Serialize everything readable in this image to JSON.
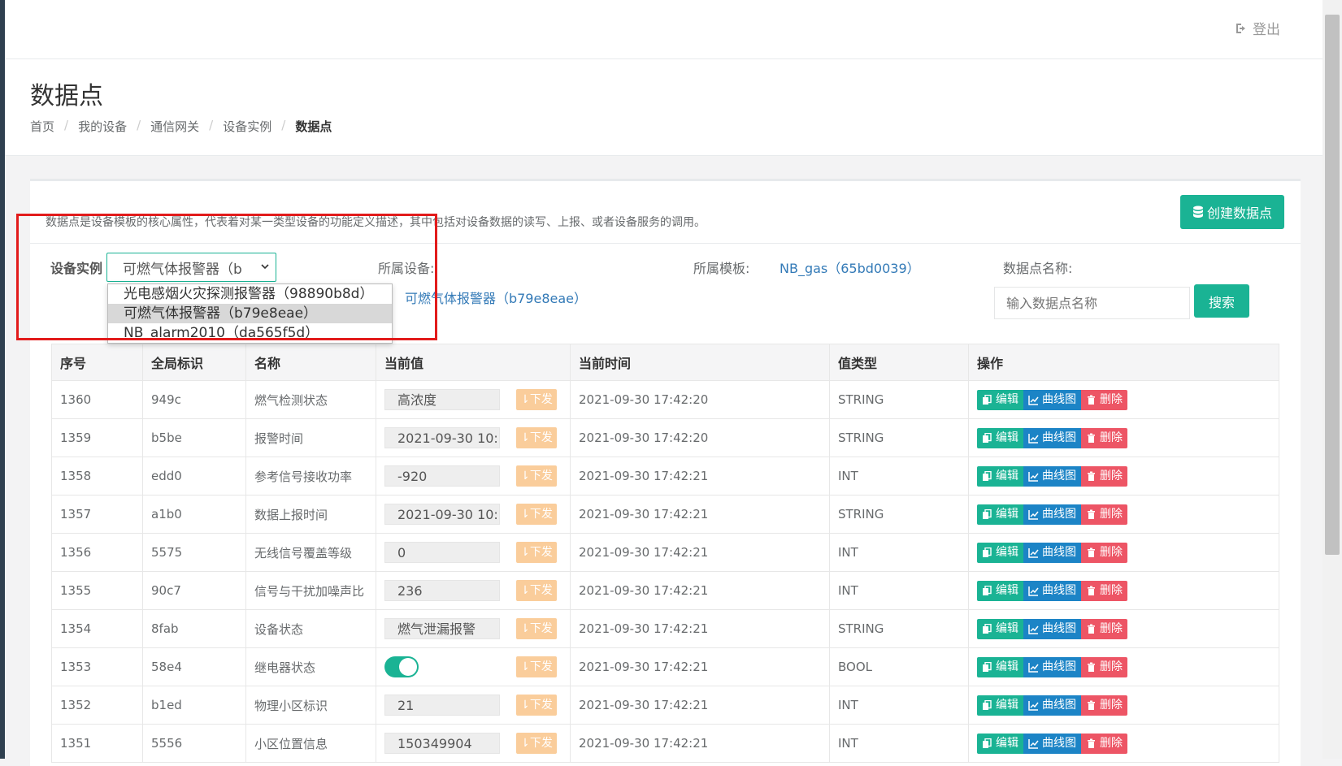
{
  "header": {
    "logout_label": "登出"
  },
  "page": {
    "title": "数据点",
    "breadcrumb": [
      "首页",
      "我的设备",
      "通信网关",
      "设备实例",
      "数据点"
    ]
  },
  "panel": {
    "description": "数据点是设备模板的核心属性，代表着对某一类型设备的功能定义描述，其中包括对设备数据的读写、上报、或者设备服务的调用。",
    "create_button": "创建数据点"
  },
  "filters": {
    "instance_label": "设备实例",
    "instance_selected": "可燃气体报警器（b",
    "instance_options": [
      "光电感烟火灾探测报警器（98890b8d）",
      "可燃气体报警器（b79e8eae）",
      "NB_alarm2010（da565f5d）"
    ],
    "device_label": "所属设备:",
    "device_link": "可燃气体报警器（b79e8eae）",
    "template_label": "所属模板:",
    "template_link": "NB_gas（65bd0039）",
    "dp_name_label": "数据点名称:",
    "dp_name_placeholder": "输入数据点名称",
    "search_button": "搜索"
  },
  "table": {
    "headers": [
      "序号",
      "全局标识",
      "名称",
      "当前值",
      "当前时间",
      "值类型",
      "操作"
    ],
    "send_label": "下发",
    "edit_label": "编辑",
    "chart_label": "曲线图",
    "delete_label": "删除",
    "rows": [
      {
        "id": "1360",
        "gid": "949c",
        "name": "燃气检测状态",
        "value": "高浓度",
        "time": "2021-09-30 17:42:20",
        "type": "STRING",
        "toggle": false
      },
      {
        "id": "1359",
        "gid": "b5be",
        "name": "报警时间",
        "value": "2021-09-30 10:",
        "time": "2021-09-30 17:42:20",
        "type": "STRING",
        "toggle": false
      },
      {
        "id": "1358",
        "gid": "edd0",
        "name": "参考信号接收功率",
        "value": "-920",
        "time": "2021-09-30 17:42:21",
        "type": "INT",
        "toggle": false
      },
      {
        "id": "1357",
        "gid": "a1b0",
        "name": "数据上报时间",
        "value": "2021-09-30 10:",
        "time": "2021-09-30 17:42:21",
        "type": "STRING",
        "toggle": false
      },
      {
        "id": "1356",
        "gid": "5575",
        "name": "无线信号覆盖等级",
        "value": "0",
        "time": "2021-09-30 17:42:21",
        "type": "INT",
        "toggle": false
      },
      {
        "id": "1355",
        "gid": "90c7",
        "name": "信号与干扰加噪声比",
        "value": "236",
        "time": "2021-09-30 17:42:21",
        "type": "INT",
        "toggle": false
      },
      {
        "id": "1354",
        "gid": "8fab",
        "name": "设备状态",
        "value": "燃气泄漏报警",
        "time": "2021-09-30 17:42:21",
        "type": "STRING",
        "toggle": false
      },
      {
        "id": "1353",
        "gid": "58e4",
        "name": "继电器状态",
        "value": "",
        "time": "2021-09-30 17:42:21",
        "type": "BOOL",
        "toggle": true
      },
      {
        "id": "1352",
        "gid": "b1ed",
        "name": "物理小区标识",
        "value": "21",
        "time": "2021-09-30 17:42:21",
        "type": "INT",
        "toggle": false
      },
      {
        "id": "1351",
        "gid": "5556",
        "name": "小区位置信息",
        "value": "150349904",
        "time": "2021-09-30 17:42:21",
        "type": "INT",
        "toggle": false
      }
    ]
  }
}
